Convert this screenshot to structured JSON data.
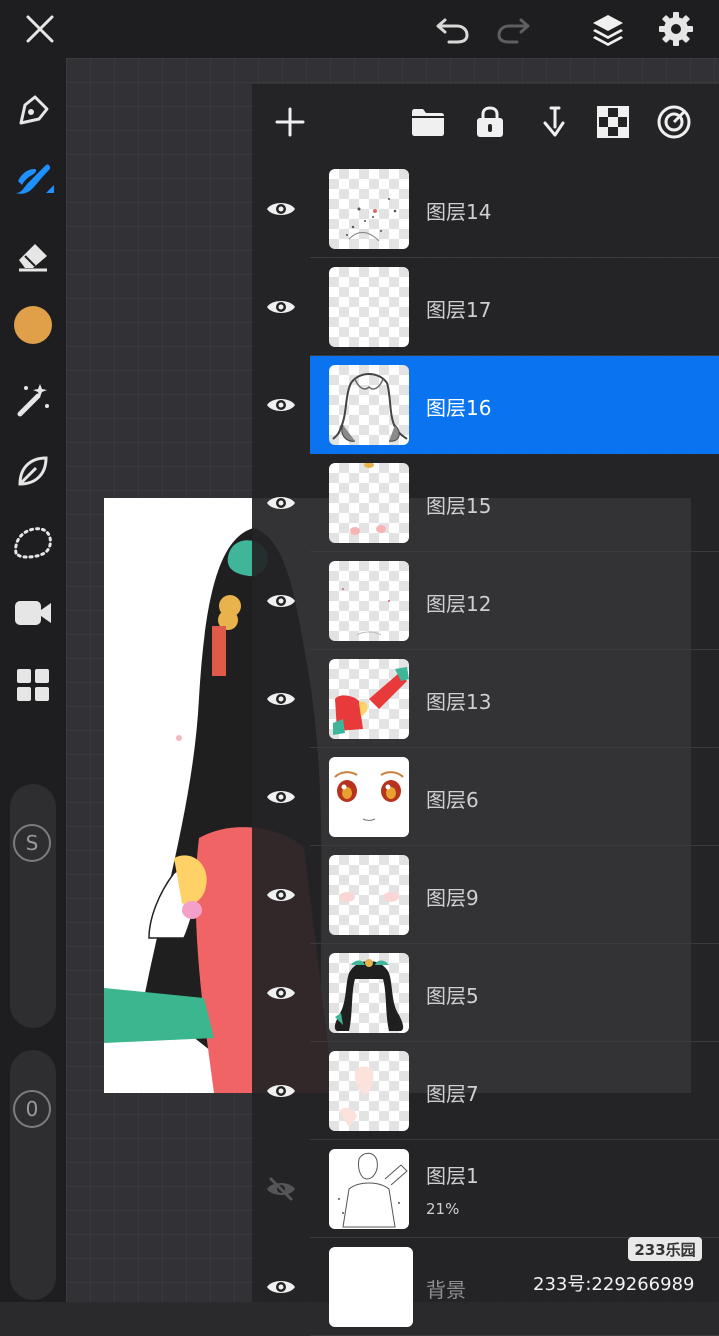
{
  "layers_panel": {
    "layers": [
      {
        "name": "图层14",
        "visible": true,
        "selected": false,
        "thumb": "sketch-lines"
      },
      {
        "name": "图层17",
        "visible": true,
        "selected": false,
        "thumb": "empty"
      },
      {
        "name": "图层16",
        "visible": true,
        "selected": true,
        "thumb": "hair-lines"
      },
      {
        "name": "图层15",
        "visible": true,
        "selected": false,
        "thumb": "blush"
      },
      {
        "name": "图层12",
        "visible": true,
        "selected": false,
        "thumb": "faint"
      },
      {
        "name": "图层13",
        "visible": true,
        "selected": false,
        "thumb": "red-clothes"
      },
      {
        "name": "图层6",
        "visible": true,
        "selected": false,
        "thumb": "face-eyes"
      },
      {
        "name": "图层9",
        "visible": true,
        "selected": false,
        "thumb": "soft-blush"
      },
      {
        "name": "图层5",
        "visible": true,
        "selected": false,
        "thumb": "hair-color"
      },
      {
        "name": "图层7",
        "visible": true,
        "selected": false,
        "thumb": "skin"
      },
      {
        "name": "图层1",
        "visible": false,
        "selected": false,
        "thumb": "lineart",
        "opacity": "21%"
      }
    ],
    "background": {
      "name": "背景",
      "visible": true
    }
  },
  "toolbar": {
    "brush_size_badge": "S",
    "opacity_badge": "0",
    "current_color": "#e0a04a"
  },
  "colors": {
    "accent": "#0a74f0",
    "panel_bg": "#242426",
    "bar_bg": "#1e1e20"
  },
  "watermark": {
    "logo": "233乐园",
    "text": "233号:229266989"
  }
}
